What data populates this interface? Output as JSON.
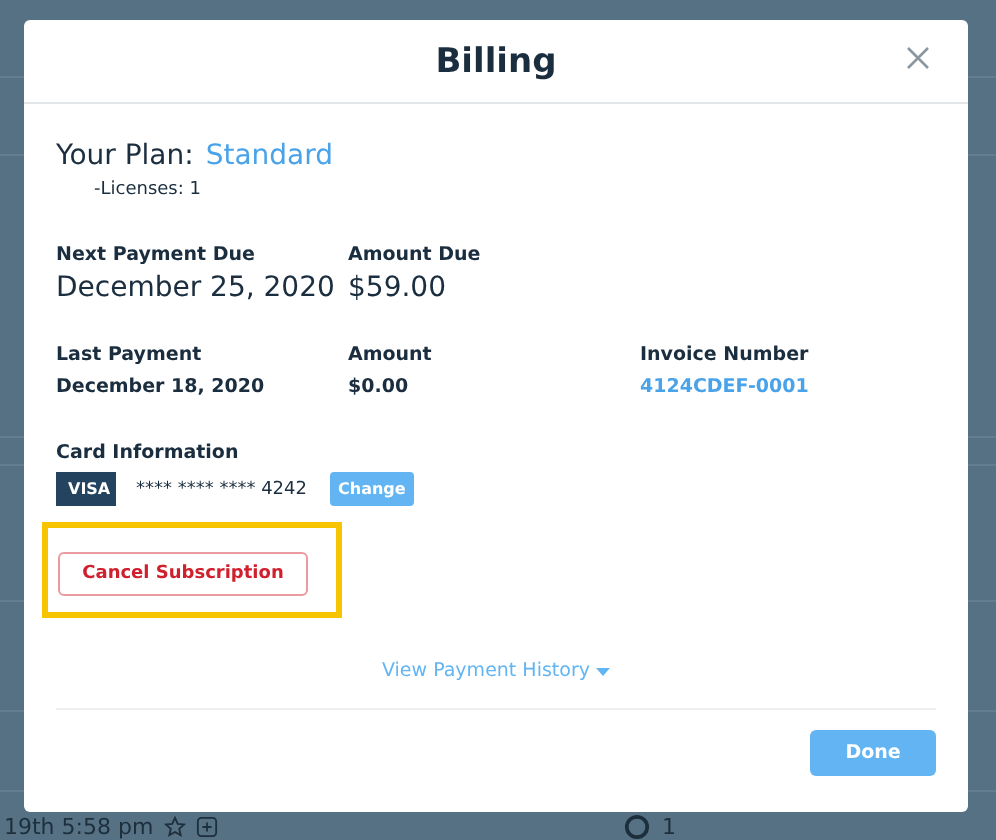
{
  "background": {
    "timestamp": "19th 5:58 pm",
    "count": "1"
  },
  "modal": {
    "title": "Billing",
    "plan": {
      "label": "Your Plan:",
      "name": "Standard",
      "licenses": "-Licenses: 1"
    },
    "next_payment": [
      {
        "label": "Next Payment Due",
        "value": "December 25, 2020",
        "kind": "text"
      },
      {
        "label": "Amount Due",
        "value": "$59.00",
        "kind": "text"
      }
    ],
    "last_payment": [
      {
        "label": "Last Payment",
        "value": "December 18, 2020",
        "kind": "text"
      },
      {
        "label": "Amount",
        "value": "$0.00",
        "kind": "text"
      },
      {
        "label": "Invoice Number",
        "value": "4124CDEF-0001",
        "kind": "link"
      }
    ],
    "card": {
      "label": "Card Information",
      "brand": "VISA",
      "number": "**** **** **** 4242",
      "change": "Change"
    },
    "cancel": {
      "label": "Cancel Subscription",
      "highlighted": true
    },
    "history": "View Payment History",
    "done": "Done"
  }
}
